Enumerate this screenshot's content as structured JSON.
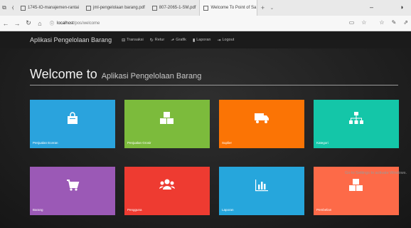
{
  "browser": {
    "tabs": [
      {
        "label": "1745-IO-manajemen-rantai",
        "active": false
      },
      {
        "label": "jml-pengelolaan barang.pdf",
        "active": false
      },
      {
        "label": "807-2065-1-SM.pdf",
        "active": false
      },
      {
        "label": "Welcome To Point of Sa",
        "active": true
      }
    ],
    "new_tab": "+",
    "tab_menu": "⌄",
    "address": {
      "host": "localhost",
      "path": "/pos/welcome"
    }
  },
  "app": {
    "brand": "Aplikasi Pengelolaan Barang",
    "nav": [
      {
        "label": "Transaksi",
        "icon": "cart-icon",
        "glyph": "⊟"
      },
      {
        "label": "Retur",
        "icon": "refresh-icon",
        "glyph": "↻"
      },
      {
        "label": "Grafik",
        "icon": "chart-icon",
        "glyph": "⬏"
      },
      {
        "label": "Laporan",
        "icon": "file-icon",
        "glyph": "▮"
      },
      {
        "label": "Logout",
        "icon": "logout-icon",
        "glyph": "⇥"
      }
    ]
  },
  "welcome": {
    "big": "Welcome to",
    "small": "Aplikasi Pengelolaan Barang"
  },
  "tiles": [
    {
      "label": "Penjualan Eceran",
      "icon": "shopping-bag-icon",
      "glyph": "👜",
      "color": "#2aa3dd"
    },
    {
      "label": "Penjualan Grosir",
      "icon": "cubes-icon",
      "glyph": "⬢",
      "color": "#7cbb3c"
    },
    {
      "label": "Suplier",
      "icon": "truck-icon",
      "glyph": "🚚",
      "color": "#fb7405"
    },
    {
      "label": "Kategori",
      "icon": "sitemap-icon",
      "glyph": "品",
      "color": "#14c6a8"
    },
    {
      "label": "Barang",
      "icon": "cart-icon",
      "glyph": "🛒",
      "color": "#9b59b6"
    },
    {
      "label": "Pengguna",
      "icon": "users-icon",
      "glyph": "👥",
      "color": "#ee3b31"
    },
    {
      "label": "Laporan",
      "icon": "bar-chart-icon",
      "glyph": "📊",
      "color": "#26a6dc"
    },
    {
      "label": "Pembelian",
      "icon": "cubes-icon",
      "glyph": "⬢",
      "color": "#fd6a48"
    }
  ],
  "watermark": "Go to Settings to activate Windows."
}
